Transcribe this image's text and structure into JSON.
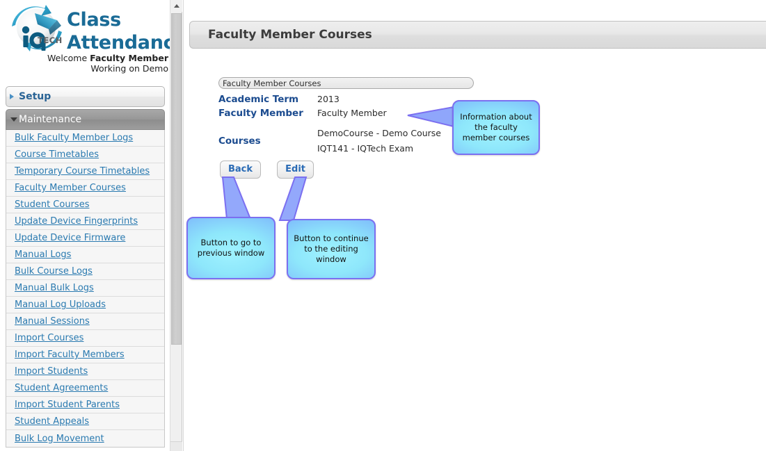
{
  "brand": {
    "logo_icon": "iqtech-circular-arrows-logo",
    "title_line1": "Class",
    "title_line2": "Attendance",
    "welcome_prefix": "Welcome ",
    "welcome_user": "Faculty Member",
    "working_on": "Working on Demo",
    "accent_color": "#1a6b96"
  },
  "sidebar": {
    "groups": [
      {
        "label": "Setup",
        "expanded": false,
        "arrow_icon": "chevron-right-icon"
      },
      {
        "label": "Maintenance",
        "expanded": true,
        "arrow_icon": "chevron-down-icon"
      }
    ],
    "items": [
      {
        "label": "Bulk Faculty Member Logs"
      },
      {
        "label": "Course Timetables"
      },
      {
        "label": "Temporary Course Timetables"
      },
      {
        "label": "Faculty Member Courses"
      },
      {
        "label": "Student Courses"
      },
      {
        "label": "Update Device Fingerprints"
      },
      {
        "label": "Update Device Firmware"
      },
      {
        "label": "Manual Logs"
      },
      {
        "label": "Bulk Course Logs"
      },
      {
        "label": "Manual Bulk Logs"
      },
      {
        "label": "Manual Log Uploads"
      },
      {
        "label": "Manual Sessions"
      },
      {
        "label": "Import Courses"
      },
      {
        "label": "Import Faculty Members"
      },
      {
        "label": "Import Students"
      },
      {
        "label": "Student Agreements"
      },
      {
        "label": "Import Student Parents"
      },
      {
        "label": "Student Appeals"
      },
      {
        "label": "Bulk Log Movement"
      }
    ],
    "link_color": "#2a7ab0"
  },
  "scrollbar": {
    "up_icon": "chevron-up-icon",
    "down_icon": "scroll-down-button"
  },
  "main": {
    "page_title": "Faculty Member Courses",
    "panel": {
      "legend": "Faculty Member Courses",
      "fields": [
        {
          "label": "Academic Term",
          "value": "2013"
        },
        {
          "label": "Faculty Member",
          "value": "Faculty Member"
        }
      ],
      "courses_label": "Courses",
      "courses": [
        "DemoCourse - Demo Course",
        "IQT141 - IQTech Exam"
      ]
    },
    "buttons": {
      "back": "Back",
      "edit": "Edit"
    }
  },
  "callouts": [
    {
      "id": "info",
      "text": "Information about the faculty member courses"
    },
    {
      "id": "back",
      "text": "Button to go to previous window"
    },
    {
      "id": "edit",
      "text": "Button to continue to the editing window"
    }
  ],
  "colors": {
    "callout_border": "#7b6ff0",
    "callout_fill_light": "#9ff2ff",
    "callout_fill_dark": "#8e9bfb",
    "label_blue": "#1b4b8f",
    "button_text": "#2a6bb5"
  }
}
